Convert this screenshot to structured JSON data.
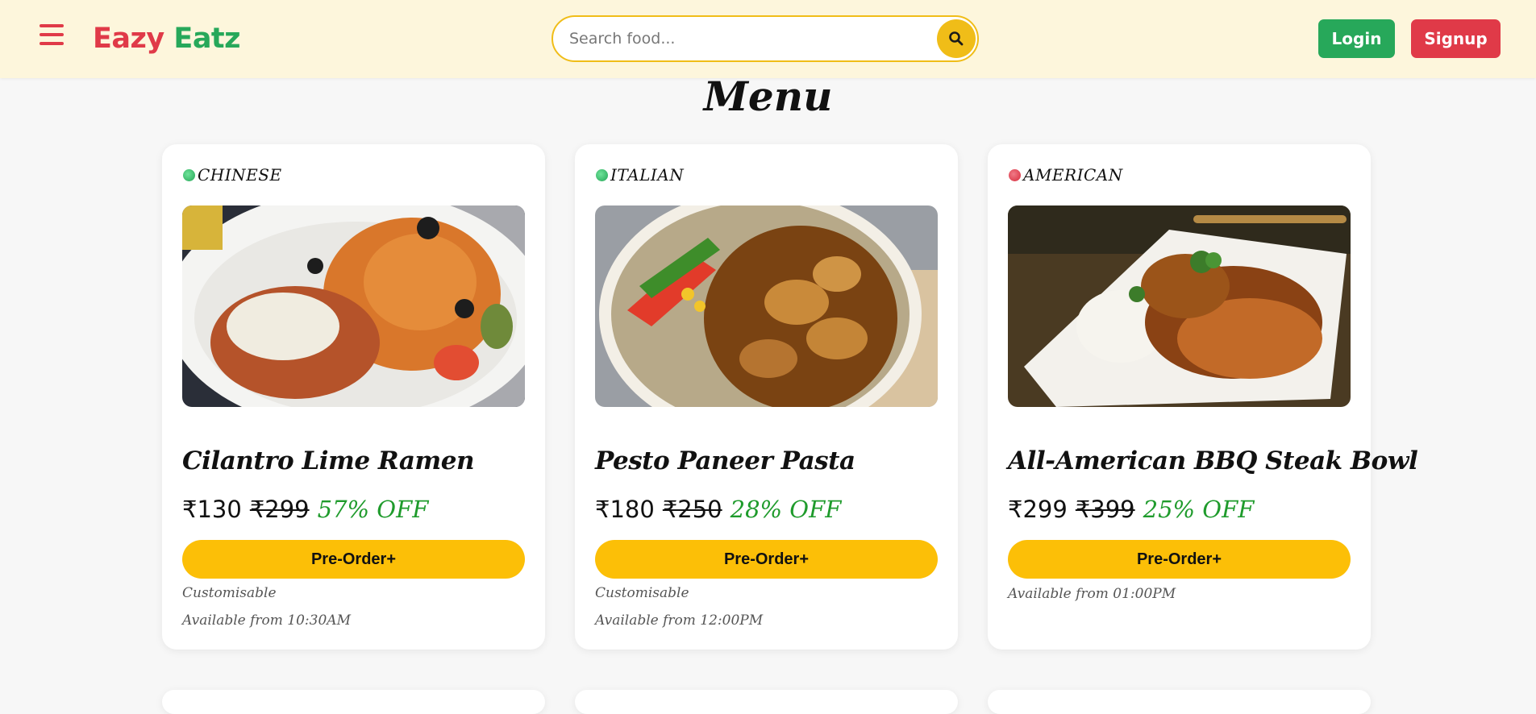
{
  "header": {
    "brand_part1": "Eazy",
    "brand_part2": "Eatz",
    "search_placeholder": "Search food...",
    "login_label": "Login",
    "signup_label": "Signup"
  },
  "page": {
    "title": "Menu"
  },
  "colors": {
    "brand_red": "#e03a48",
    "brand_green": "#27a85a",
    "accent_yellow": "#fcbf07",
    "veg_dot": "#3cc46e",
    "nonveg_dot": "#e03a48"
  },
  "cards": [
    {
      "category": "CHINESE",
      "dot_color": "veg_dot",
      "image_icon": "pasta-plate-image",
      "name": "Cilantro Lime Ramen",
      "price": "₹130",
      "original_price": "₹299",
      "discount": "57% OFF",
      "button": "Pre-Order+",
      "customisable": "Customisable",
      "availability": "Available from 10:30AM"
    },
    {
      "category": "ITALIAN",
      "dot_color": "veg_dot",
      "image_icon": "paneer-rice-bowl-image",
      "name": "Pesto Paneer Pasta",
      "price": "₹180",
      "original_price": "₹250",
      "discount": "28% OFF",
      "button": "Pre-Order+",
      "customisable": "Customisable",
      "availability": "Available from 12:00PM"
    },
    {
      "category": "AMERICAN",
      "dot_color": "nonveg_dot",
      "image_icon": "chicken-rice-plate-image",
      "name": "All-American BBQ Steak Bowl",
      "price": "₹299",
      "original_price": "₹399",
      "discount": "25% OFF",
      "button": "Pre-Order+",
      "availability": "Available from 01:00PM"
    }
  ]
}
